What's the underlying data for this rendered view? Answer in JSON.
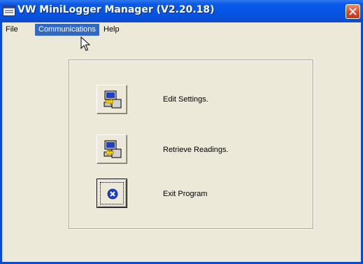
{
  "window": {
    "title": "VW MiniLogger Manager (V2.20.18)",
    "app_icon": "window-icon",
    "close_icon": "close-icon"
  },
  "menu": {
    "items": [
      {
        "label": "File",
        "active": false
      },
      {
        "label": "Communications",
        "active": true
      },
      {
        "label": "Help",
        "active": false
      }
    ]
  },
  "actions": [
    {
      "label": "Edit Settings.",
      "icon": "computer-send-icon"
    },
    {
      "label": "Retrieve Readings.",
      "icon": "computer-receive-icon"
    },
    {
      "label": "Exit Program",
      "icon": "close-circle-icon"
    }
  ],
  "colors": {
    "title_bar": "#0554e3",
    "menu_highlight": "#316ac5",
    "face": "#ece9d8",
    "close_button": "#d9442b",
    "exit_icon": "#1f3fc8"
  }
}
